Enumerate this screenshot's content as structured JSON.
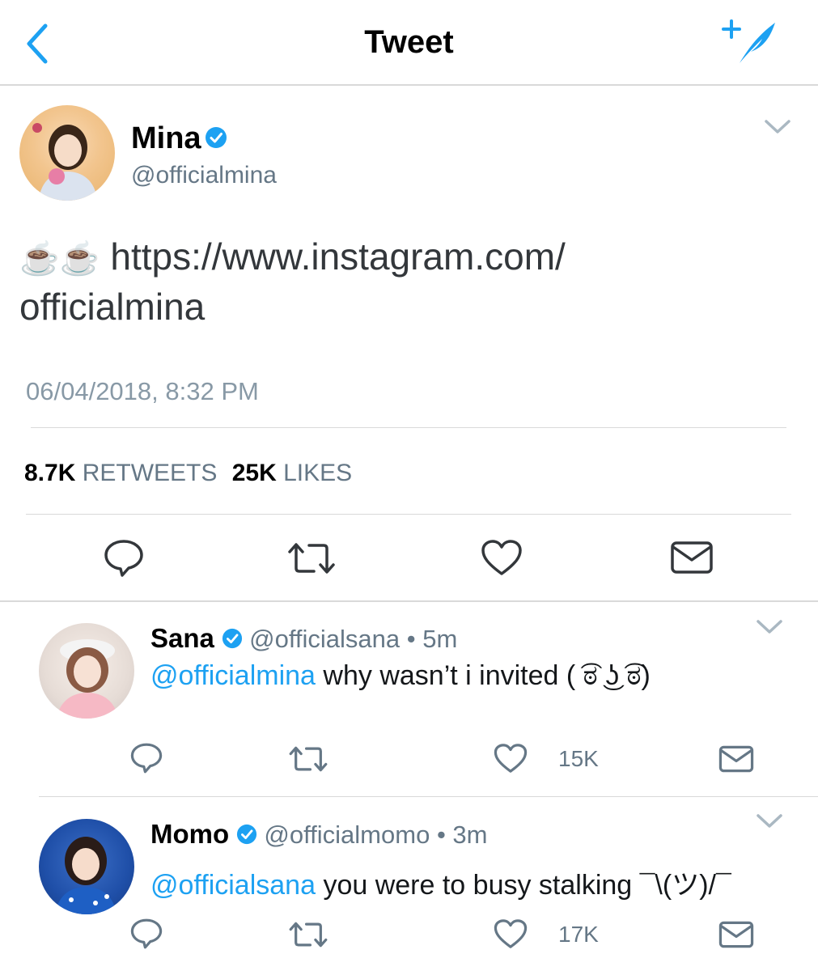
{
  "nav": {
    "title": "Tweet"
  },
  "tweet": {
    "name": "Mina",
    "handle": "@officialmina",
    "emoji": "☕☕",
    "link_line1": "https://www.instagram.com/",
    "link_line2": "officialmina",
    "timestamp": "06/04/2018, 8:32 PM",
    "retweets_count": "8.7K",
    "retweets_label": "RETWEETS",
    "likes_count": "25K",
    "likes_label": "LIKES"
  },
  "replies": [
    {
      "name": "Sana",
      "handle": "@officialsana",
      "time": "• 5m",
      "mention": "@officialmina",
      "text": " why wasn’t i invited ( ͡ಠ ͜ʖ ͡ಠ)",
      "likes": "15K"
    },
    {
      "name": "Momo",
      "handle": "@officialmomo",
      "time": "• 3m",
      "mention": "@officialsana",
      "text": " you were to busy stalking ¯\\(ツ)/¯",
      "likes": "17K"
    }
  ],
  "colors": {
    "accent": "#1da1f2",
    "muted": "#657786",
    "icon": "#33373b"
  }
}
